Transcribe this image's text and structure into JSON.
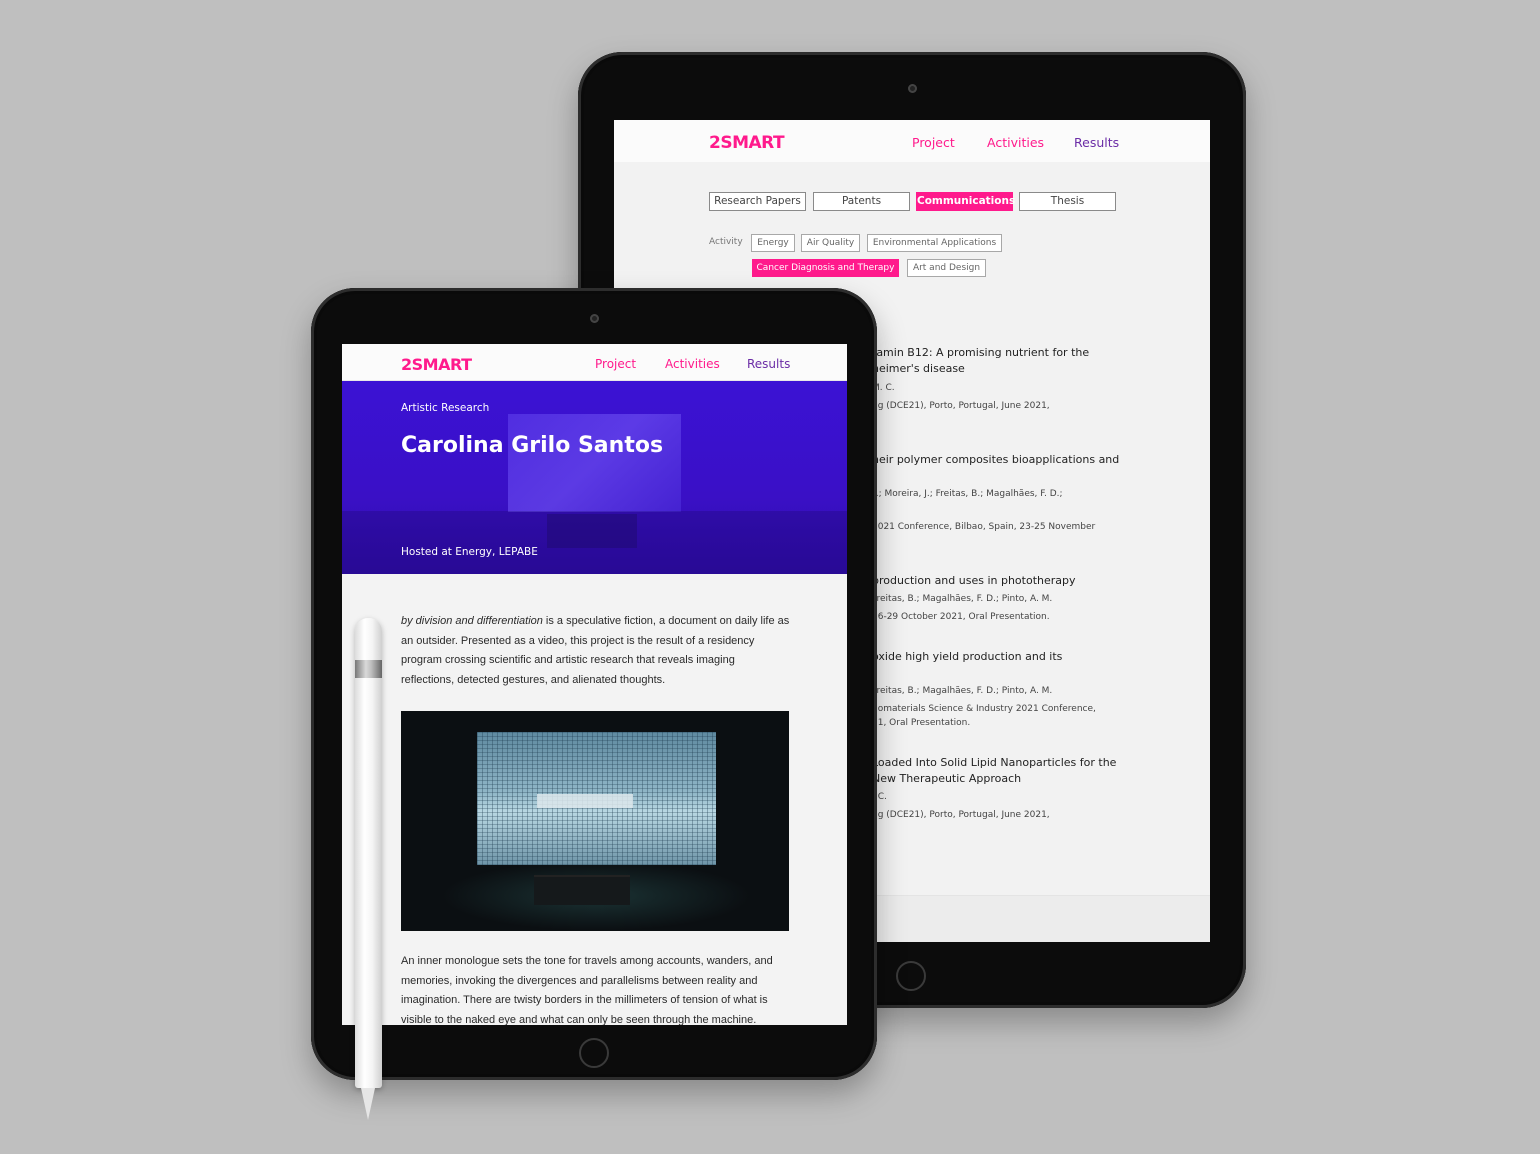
{
  "brand": {
    "logo_text": "2SMART",
    "pink": "#ff1a8c",
    "purple": "#6b2ca6",
    "hero_blue": "#3b12d4"
  },
  "back_page": {
    "nav": {
      "project": "Project",
      "activities": "Activities",
      "results": "Results"
    },
    "tabs": [
      "Research Papers",
      "Patents",
      "Communications",
      "Thesis"
    ],
    "active_tab": "Communications",
    "filter_label": "Activity",
    "chips": [
      "Energy",
      "Air Quality",
      "Environmental Applications",
      "Cancer Diagnosis and Therapy",
      "Art and Design"
    ],
    "active_chip": "Cancer Diagnosis and Therapy",
    "publications": [
      {
        "title_1": "tamin B12: A promising nutrient for the",
        "title_2": "heimer's disease",
        "meta_1": "M. C.",
        "meta_2": "ng (DCE21), Porto, Portugal, June 2021,"
      },
      {
        "title_1": "heir polymer composites bioapplications and",
        "meta_1": "F.; Moreira, J.; Freitas, B.; Magalhães, F. D.;",
        "meta_2": "2021 Conference, Bilbao, Spain, 23-25 November"
      },
      {
        "title_1": "production and uses in phototherapy",
        "meta_1": "Freitas, B.; Magalhães, F. D.; Pinto, A. M.",
        "meta_2": "26-29 October 2021, Oral Presentation."
      },
      {
        "title_1": "oxide high yield production and its",
        "meta_1": "Freitas, B.; Magalhães, F. D.; Pinto, A. M.",
        "meta_2": "nomaterials Science & Industry 2021 Conference,",
        "meta_3": "21, Oral Presentation."
      },
      {
        "title_1": "Loaded Into Solid Lipid Nanoparticles for the",
        "title_2": "New Therapeutic Approach",
        "meta_1": ". C.",
        "meta_2": "ng (DCE21), Porto, Portugal, June 2021,"
      }
    ]
  },
  "front_page": {
    "nav": {
      "project": "Project",
      "activities": "Activities",
      "results": "Results"
    },
    "hero": {
      "kicker": "Artistic Research",
      "title": "Carolina Grilo Santos",
      "hosted": "Hosted at Energy, LEPABE"
    },
    "intro_italic": "by division and differentiation",
    "intro_rest": " is a speculative fiction, a document on daily life as an outsider. Presented as a video, this project is the result of a residency program crossing scientific and artistic research that reveals imaging reflections, detected gestures, and alienated thoughts.",
    "second_paragraph": "An inner monologue sets the tone for travels among accounts, wanders, and memories, invoking the divergences and parallelisms between reality and imagination. There are twisty borders in the millimeters of tension of what is visible to the naked eye and what can only be seen through the machine."
  }
}
